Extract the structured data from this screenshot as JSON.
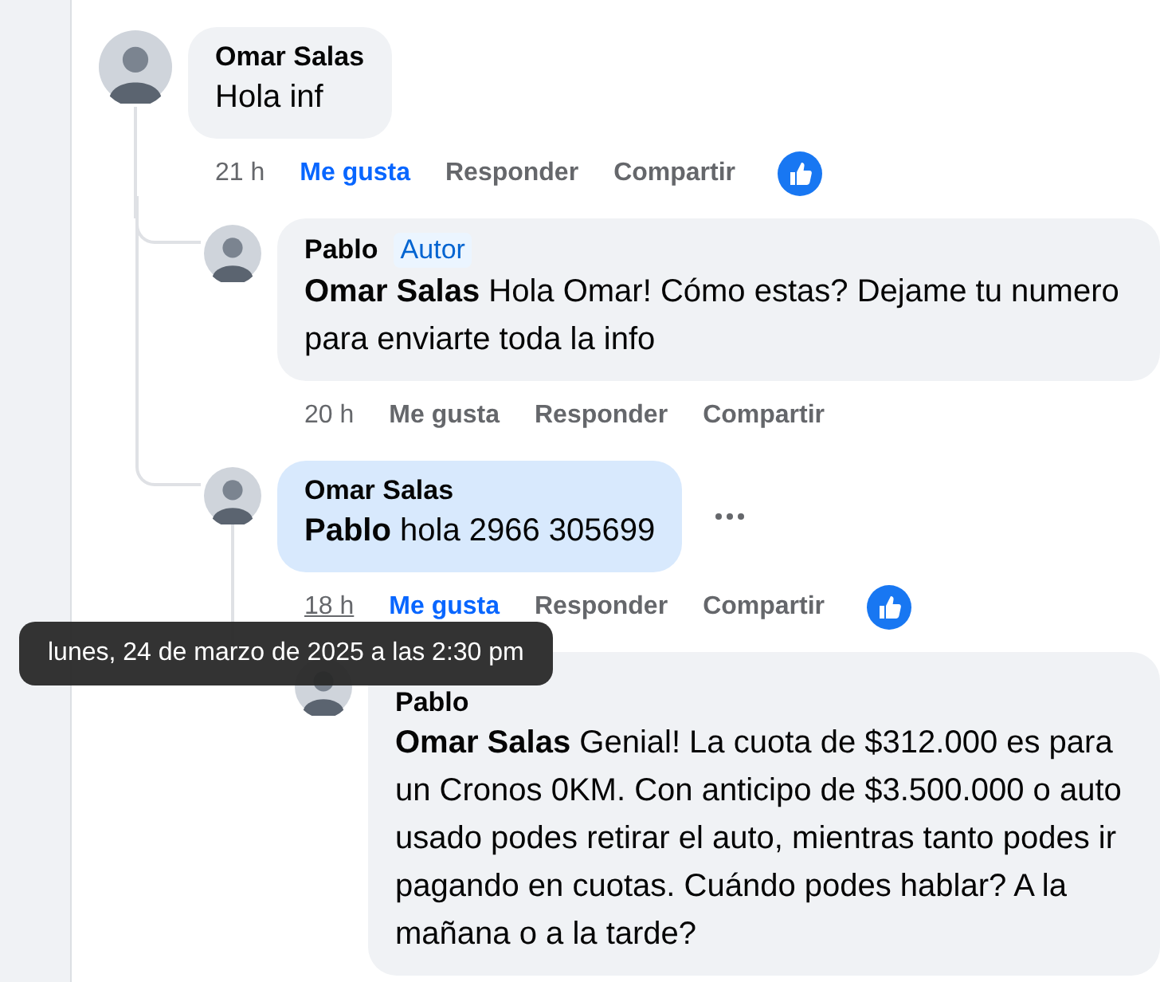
{
  "comments": [
    {
      "author": "Omar Salas",
      "text": "Hola inf",
      "time": "21 h",
      "time_hovered": false,
      "like_label": "Me gusta",
      "liked": true,
      "reply_label": "Responder",
      "share_label": "Compartir",
      "reacted": true,
      "highlighted": false,
      "children": [
        {
          "author": "Pablo",
          "badge": "Autor",
          "text": "**Omar Salas** Hola Omar! Cómo estas? Dejame tu numero para enviarte toda la info",
          "time": "20 h",
          "time_hovered": false,
          "like_label": "Me gusta",
          "liked": false,
          "reply_label": "Responder",
          "share_label": "Compartir",
          "reacted": false,
          "highlighted": false
        },
        {
          "author": "Omar Salas",
          "text": "**Pablo** hola 2966 305699",
          "time": "18 h",
          "time_hovered": true,
          "like_label": "Me gusta",
          "liked": true,
          "reply_label": "Responder",
          "share_label": "Compartir",
          "reacted": true,
          "highlighted": true,
          "more_menu": true,
          "children": [
            {
              "author": "Pablo",
              "text": "**Omar Salas** Genial! La cuota de $312.000 es para un Cronos 0KM. Con anticipo de $3.500.000 o auto usado podes retirar el auto, mientras tanto podes ir pagando en cuotas. Cuándo podes hablar? A la mañana o a la tarde?",
              "highlighted": false
            }
          ]
        }
      ]
    }
  ],
  "tooltip": {
    "text": "lunes, 24 de marzo de 2025 a las 2:30 pm"
  }
}
